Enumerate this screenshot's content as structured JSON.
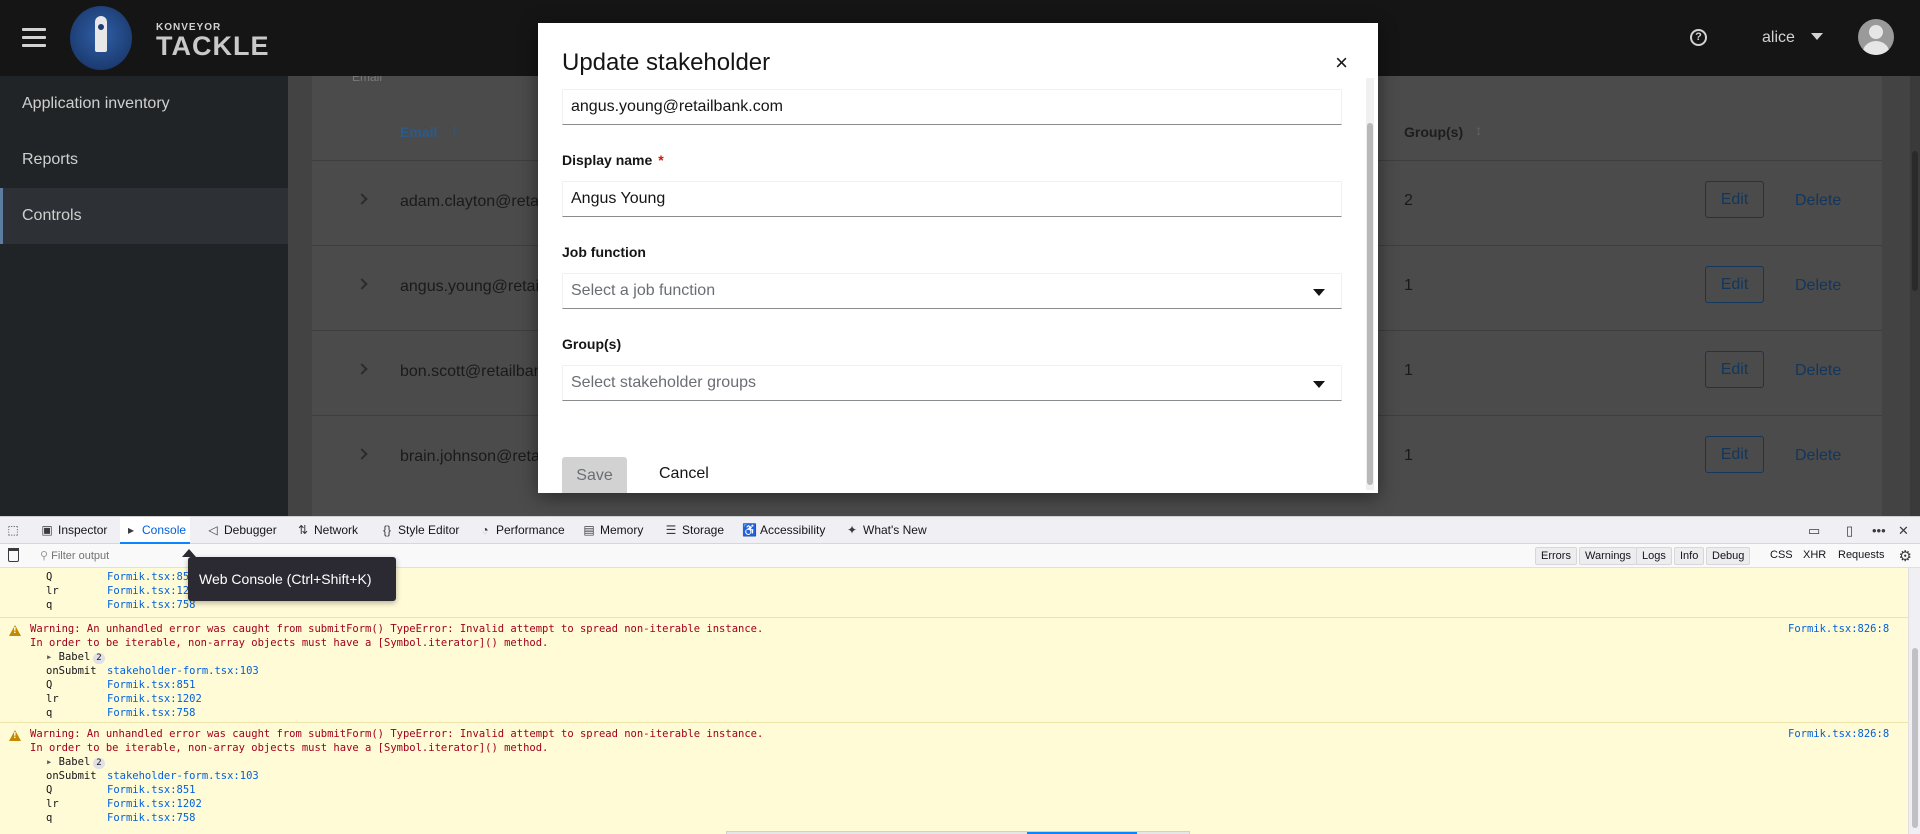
{
  "app": {
    "brand_small": "KONVEYOR",
    "brand_big": "TACKLE",
    "user": "alice"
  },
  "sidebar": {
    "items": [
      {
        "label": "Application inventory"
      },
      {
        "label": "Reports"
      },
      {
        "label": "Controls"
      }
    ]
  },
  "table": {
    "header_email": "Email",
    "header_groups": "Group(s)",
    "toolbar_fragment": "Email",
    "rows": [
      {
        "email": "adam.clayton@retai",
        "groups": "2",
        "edit": "Edit",
        "delete": "Delete"
      },
      {
        "email": "angus.young@retail",
        "groups": "1",
        "edit": "Edit",
        "delete": "Delete"
      },
      {
        "email": "bon.scott@retailbar",
        "groups": "1",
        "edit": "Edit",
        "delete": "Delete"
      },
      {
        "email": "brain.johnson@reta",
        "groups": "1",
        "edit": "Edit",
        "delete": "Delete"
      }
    ]
  },
  "modal": {
    "title": "Update stakeholder",
    "close": "×",
    "email_value": "angus.young@retailbank.com",
    "display_name_label": "Display name",
    "required_mark": "*",
    "display_name_value": "Angus Young",
    "job_function_label": "Job function",
    "job_function_placeholder": "Select a job function",
    "groups_label": "Group(s)",
    "groups_placeholder": "Select stakeholder groups",
    "save": "Save",
    "cancel": "Cancel"
  },
  "devtools": {
    "tabs": [
      "Inspector",
      "Console",
      "Debugger",
      "Network",
      "Style Editor",
      "Performance",
      "Memory",
      "Storage",
      "Accessibility",
      "What's New"
    ],
    "filter_placeholder": "Filter output",
    "filters": [
      "Errors",
      "Warnings",
      "Logs",
      "Info",
      "Debug"
    ],
    "filters_plain": [
      "CSS",
      "XHR",
      "Requests"
    ],
    "tooltip": "Web Console (Ctrl+Shift+K)",
    "first_stack": [
      {
        "fn": "Q",
        "loc": "Formik.tsx:851"
      },
      {
        "fn": "lr",
        "loc": "Formik.tsx:1202"
      },
      {
        "fn": "q",
        "loc": "Formik.tsx:758"
      }
    ],
    "warning": {
      "line1": "Warning: An unhandled error was caught from submitForm() TypeError: Invalid attempt to spread non-iterable instance.",
      "line2": "In order to be iterable, non-array objects must have a [Symbol.iterator]() method.",
      "source": "Formik.tsx:826:8",
      "babel": "Babel",
      "babel_count": "2",
      "stack": [
        {
          "fn": "onSubmit",
          "loc": "stakeholder-form.tsx:103"
        },
        {
          "fn": "Q",
          "loc": "Formik.tsx:851"
        },
        {
          "fn": "lr",
          "loc": "Formik.tsx:1202"
        },
        {
          "fn": "q",
          "loc": "Formik.tsx:758"
        }
      ]
    }
  },
  "colors": {
    "accent": "#0066cc",
    "link": "#0060df",
    "warning_bg": "#fffbd6",
    "warning_text": "#a2001b"
  }
}
